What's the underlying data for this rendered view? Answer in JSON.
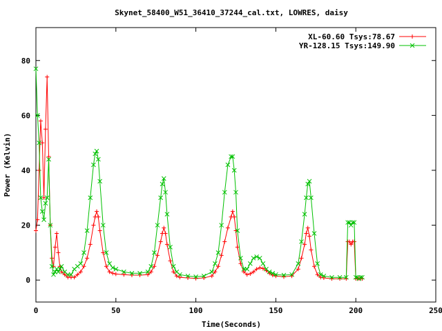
{
  "chart_data": {
    "type": "line",
    "title": "Skynet_58400_W51_36410_37244_cal.txt, LOWRES, daisy",
    "xlabel": "Time(Seconds)",
    "ylabel": "Power (Kelvin)",
    "xlim": [
      0,
      250
    ],
    "ylim": [
      -8,
      92
    ],
    "xticks": [
      0,
      50,
      100,
      150,
      200,
      250
    ],
    "yticks": [
      0,
      20,
      40,
      60,
      80
    ],
    "legend_position": "top-right",
    "grid": false,
    "series": [
      {
        "name": "XL-60.60 Tsys:78.67",
        "color": "#ff0000",
        "marker": "+",
        "x": [
          0,
          1,
          2,
          3,
          4,
          5,
          6,
          7,
          8,
          9,
          10,
          11,
          12,
          13,
          14,
          15,
          16,
          18,
          20,
          22,
          24,
          26,
          28,
          30,
          32,
          34,
          36,
          37,
          38,
          39,
          40,
          42,
          44,
          46,
          48,
          50,
          55,
          60,
          65,
          70,
          72,
          74,
          76,
          78,
          79,
          80,
          81,
          82,
          84,
          86,
          88,
          90,
          95,
          100,
          105,
          110,
          112,
          114,
          116,
          118,
          120,
          122,
          123,
          124,
          125,
          126,
          128,
          130,
          132,
          134,
          136,
          138,
          140,
          142,
          144,
          146,
          148,
          150,
          155,
          160,
          164,
          166,
          168,
          169,
          170,
          171,
          172,
          174,
          176,
          178,
          180,
          185,
          190,
          194,
          195,
          196,
          197,
          198,
          199,
          200,
          201,
          202,
          203,
          204
        ],
        "values": [
          18,
          22,
          40,
          58,
          50,
          30,
          55,
          74,
          45,
          20,
          8,
          5,
          12,
          17,
          10,
          5,
          3,
          2,
          1,
          1,
          1,
          2,
          3,
          5,
          8,
          13,
          20,
          23,
          25,
          23,
          18,
          10,
          5,
          3,
          2.5,
          2.2,
          2,
          1.8,
          1.8,
          2,
          3,
          5,
          9,
          14,
          17,
          19,
          17,
          13,
          7,
          3,
          1.5,
          1,
          0.8,
          0.6,
          0.8,
          1.5,
          3,
          5,
          9,
          14,
          19,
          23,
          25,
          23,
          18,
          12,
          6,
          3,
          2,
          2.3,
          3,
          4,
          4.5,
          4.2,
          3.5,
          2.5,
          1.8,
          1.5,
          1.2,
          1.5,
          4,
          8,
          13,
          17,
          19,
          16,
          11,
          5,
          2,
          1,
          0.8,
          0.5,
          0.5,
          0.5,
          14,
          14,
          13,
          14,
          14,
          0.5,
          0.5,
          0.5,
          0.5,
          0.5
        ]
      },
      {
        "name": "YR-128.15 Tsys:149.90",
        "color": "#00c000",
        "marker": "x",
        "x": [
          0,
          1,
          2,
          3,
          4,
          5,
          6,
          7,
          8,
          9,
          10,
          11,
          12,
          13,
          14,
          15,
          16,
          18,
          20,
          22,
          24,
          26,
          28,
          30,
          32,
          34,
          36,
          37,
          38,
          39,
          40,
          42,
          44,
          46,
          48,
          50,
          55,
          60,
          65,
          70,
          72,
          74,
          76,
          78,
          79,
          80,
          81,
          82,
          84,
          86,
          88,
          90,
          95,
          100,
          105,
          110,
          112,
          114,
          116,
          118,
          120,
          122,
          123,
          124,
          125,
          126,
          128,
          130,
          132,
          134,
          136,
          138,
          140,
          142,
          144,
          146,
          148,
          150,
          155,
          160,
          164,
          166,
          168,
          169,
          170,
          171,
          172,
          174,
          176,
          178,
          180,
          185,
          190,
          194,
          195,
          196,
          197,
          198,
          199,
          200,
          201,
          202,
          203,
          204
        ],
        "values": [
          77,
          60,
          50,
          30,
          25,
          22,
          28,
          30,
          44,
          20,
          5,
          2,
          3,
          4,
          3,
          4,
          5,
          3,
          2,
          2,
          4,
          5,
          6,
          10,
          18,
          30,
          42,
          46,
          47,
          44,
          36,
          20,
          10,
          6,
          4.5,
          4,
          3,
          2.5,
          2.5,
          3,
          5,
          10,
          20,
          30,
          35,
          37,
          32,
          24,
          12,
          5,
          3,
          2,
          1.5,
          1.2,
          1.5,
          3,
          6,
          10,
          20,
          32,
          42,
          45,
          45,
          40,
          32,
          18,
          8,
          4,
          4,
          6,
          8,
          8.5,
          8,
          6,
          4,
          3,
          2.5,
          2,
          1.8,
          2,
          6,
          14,
          24,
          30,
          35,
          36,
          30,
          17,
          6,
          2,
          1.5,
          1,
          1,
          1,
          21,
          21,
          20,
          21,
          21,
          1,
          1,
          0.5,
          1,
          1
        ]
      }
    ]
  }
}
